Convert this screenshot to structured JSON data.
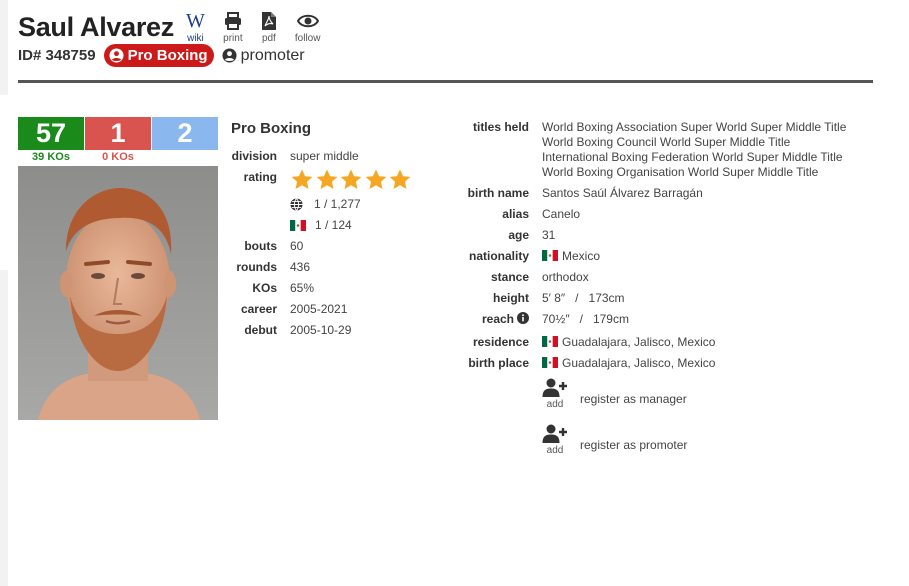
{
  "header": {
    "name": "Saul Alvarez",
    "icons": [
      {
        "label": "wiki",
        "icon": "wikipedia-icon",
        "glyph": "W"
      },
      {
        "label": "print",
        "icon": "print-icon"
      },
      {
        "label": "pdf",
        "icon": "pdf-icon"
      },
      {
        "label": "follow",
        "icon": "eye-icon"
      }
    ],
    "id_text": "ID# 348759",
    "badge": "Pro Boxing",
    "role": "promoter"
  },
  "record": {
    "wins": "57",
    "losses": "1",
    "draws": "2",
    "win_kos": "39 KOs",
    "loss_kos": "0 KOs"
  },
  "colors": {
    "win": "#1a8a1a",
    "loss": "#d9534f",
    "draw": "#8ab8ee",
    "badge": "#cc1a1a",
    "star": "#f5a623"
  },
  "pro": {
    "title": "Pro Boxing",
    "division_label": "division",
    "division": "super middle",
    "rating_label": "rating",
    "rating_stars": 5,
    "world_rank": "1 / 1,277",
    "country_rank": "1 / 124",
    "bouts_label": "bouts",
    "bouts": "60",
    "rounds_label": "rounds",
    "rounds": "436",
    "kos_label": "KOs",
    "kos": "65%",
    "career_label": "career",
    "career": "2005-2021",
    "debut_label": "debut",
    "debut": "2005-10-29"
  },
  "bio": {
    "titles_label": "titles held",
    "titles": [
      "World Boxing Association Super World Super Middle Title",
      "World Boxing Council World Super Middle Title",
      "International Boxing Federation World Super Middle Title",
      "World Boxing Organisation World Super Middle Title"
    ],
    "birth_name_label": "birth name",
    "birth_name": "Santos Saúl Álvarez Barragán",
    "alias_label": "alias",
    "alias": "Canelo",
    "age_label": "age",
    "age": "31",
    "nationality_label": "nationality",
    "nationality": "Mexico",
    "stance_label": "stance",
    "stance": "orthodox",
    "height_label": "height",
    "height": "5′ 8″   /   173cm",
    "reach_label": "reach",
    "reach": "70½″   /   179cm",
    "residence_label": "residence",
    "residence": "Guadalajara, Jalisco, Mexico",
    "birth_place_label": "birth place",
    "birth_place": "Guadalajara, Jalisco, Mexico"
  },
  "actions": {
    "add_label": "add",
    "register_manager": "register as manager",
    "register_promoter": "register as promoter"
  }
}
